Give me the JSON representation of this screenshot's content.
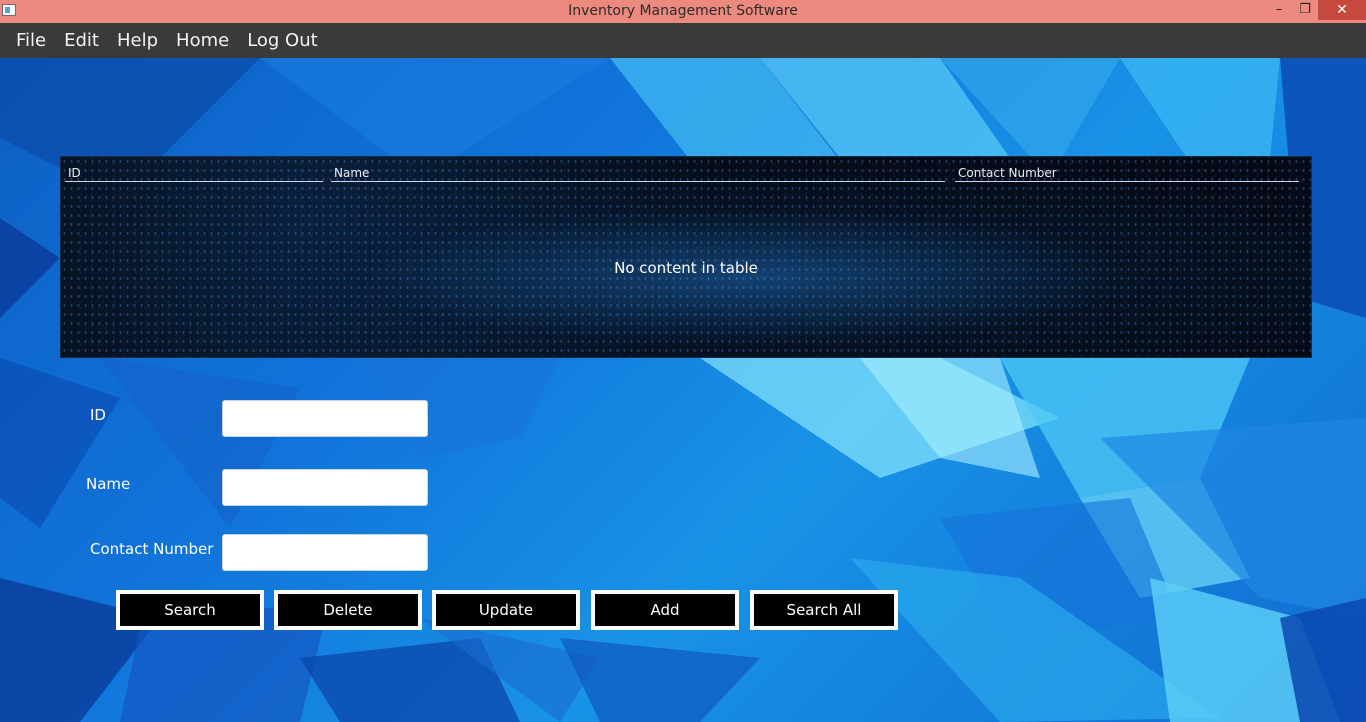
{
  "window": {
    "title": "Inventory Management Software",
    "minimize": "–",
    "maximize": "❐",
    "close": "✕"
  },
  "menu": {
    "items": [
      "File",
      "Edit",
      "Help",
      "Home",
      "Log Out"
    ]
  },
  "table": {
    "columns": [
      "ID",
      "Name",
      "Contact Number"
    ],
    "empty_message": "No content in table"
  },
  "form": {
    "id_label": "ID",
    "id_value": "",
    "name_label": "Name",
    "name_value": "",
    "contact_label": "Contact Number",
    "contact_value": ""
  },
  "buttons": {
    "search": "Search",
    "delete": "Delete",
    "update": "Update",
    "add": "Add",
    "search_all": "Search All"
  },
  "colors": {
    "titlebar": "#ec8a80",
    "menubar": "#3a3a3a",
    "background": "#1176dc",
    "close_button": "#c7483f"
  }
}
